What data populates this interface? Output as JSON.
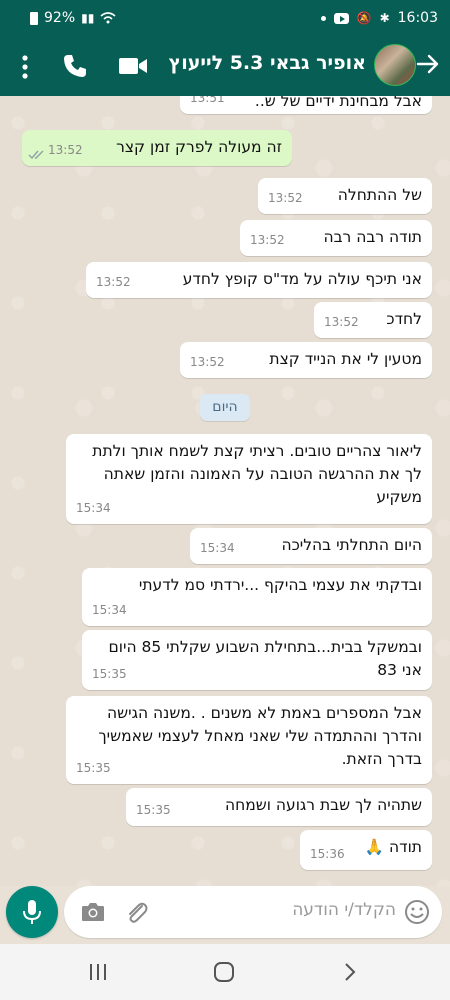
{
  "status_bar": {
    "battery": "92%",
    "time": "16:03"
  },
  "header": {
    "contact_name": "אופיר גבאי 5.3 לייעוץ"
  },
  "chat": {
    "date_separator": "היום",
    "messages": [
      {
        "text": "אבל מבחינת ידיים של ש..",
        "time": "13:51",
        "direction": "in"
      },
      {
        "text": "זה מעולה לפרק זמן קצר",
        "time": "13:52",
        "direction": "out"
      },
      {
        "text": "של ההתחלה",
        "time": "13:52",
        "direction": "in"
      },
      {
        "text": "תודה רבה רבה",
        "time": "13:52",
        "direction": "in"
      },
      {
        "text": "אני תיכף עולה על מד\"ס קופץ לחדע",
        "time": "13:52",
        "direction": "in"
      },
      {
        "text": "לחדכ",
        "time": "13:52",
        "direction": "in"
      },
      {
        "text": "מטעין לי את הנייד קצת",
        "time": "13:52",
        "direction": "in"
      },
      {
        "text": "ליאור צהריים טובים. רציתי קצת לשמח אותך ולתת לך את ההרגשה הטובה על האמונה והזמן שאתה משקיע",
        "time": "15:34",
        "direction": "in"
      },
      {
        "text": "היום התחלתי בהליכה",
        "time": "15:34",
        "direction": "in"
      },
      {
        "text": "ובדקתי את עצמי בהיקף ...ירדתי סמ לדעתי",
        "time": "15:34",
        "direction": "in"
      },
      {
        "text": "ובמשקל בבית...בתחילת השבוע שקלתי 85 היום אני 83",
        "time": "15:35",
        "direction": "in"
      },
      {
        "text": "אבל המספרים באמת לא משנים . .משנה הגישה והדרך וההתמדה שלי שאני מאחל לעצמי שאמשיך בדרך הזאת.",
        "time": "15:35",
        "direction": "in"
      },
      {
        "text": "שתהיה לך שבת רגועה ושמחה",
        "time": "15:35",
        "direction": "in"
      },
      {
        "text": "תודה 🙏",
        "time": "15:36",
        "direction": "in"
      }
    ]
  },
  "input": {
    "placeholder": "הקלד/י הודעה"
  },
  "colors": {
    "header": "#075e54",
    "outgoing": "#dcf8c6",
    "incoming": "#ffffff",
    "mic": "#00897b"
  },
  "icons": [
    "back-arrow-icon",
    "phone-icon",
    "video-icon",
    "menu-icon",
    "emoji-icon",
    "attach-icon",
    "camera-icon",
    "mic-icon"
  ]
}
